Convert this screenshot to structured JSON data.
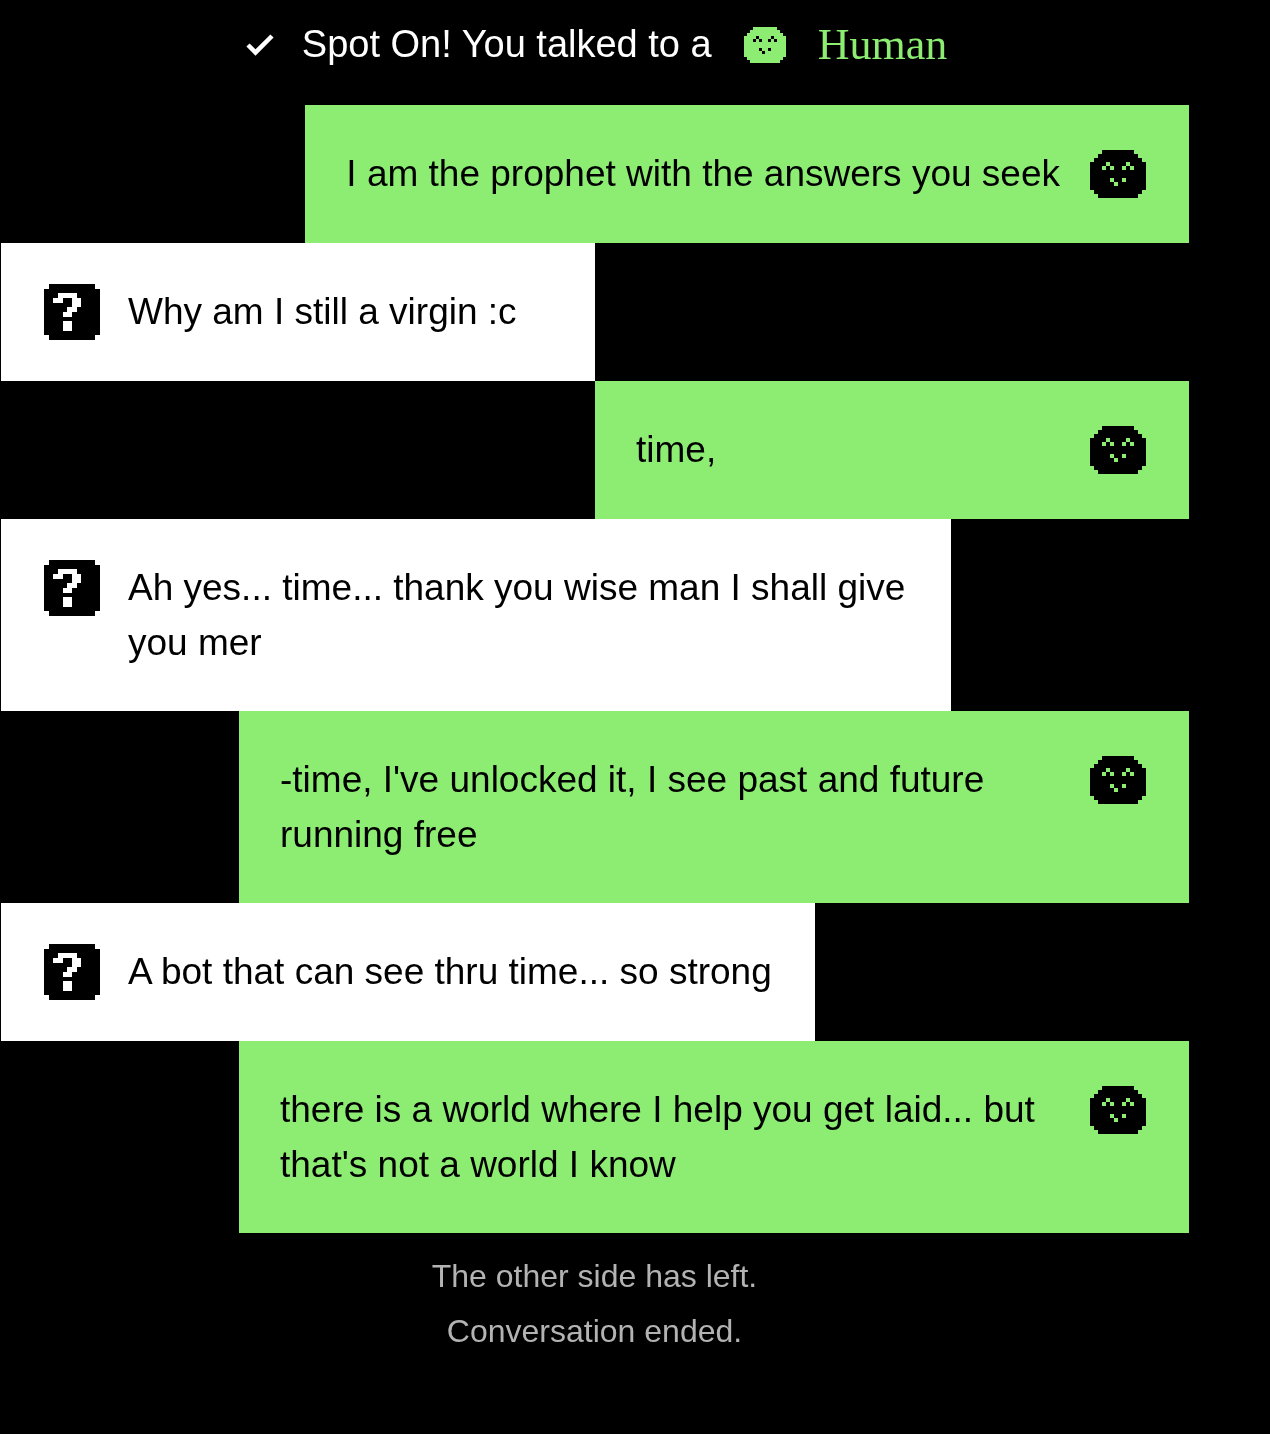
{
  "result": {
    "text": "Spot On! You talked to a",
    "answer": "Human",
    "correct": true
  },
  "messages": [
    {
      "kind": "bot",
      "text": "I am the prophet with the answers you seek"
    },
    {
      "kind": "user",
      "text": "Why am I still a virgin :c"
    },
    {
      "kind": "bot",
      "text": "time,"
    },
    {
      "kind": "user",
      "text": "Ah yes... time... thank you wise man I shall give you mer"
    },
    {
      "kind": "bot",
      "text": "-time, I've unlocked it, I see past and future running free"
    },
    {
      "kind": "user",
      "text": "A bot that can see thru time... so strong"
    },
    {
      "kind": "bot",
      "text": "there is a world where I help you get laid... but that's not a world I know"
    }
  ],
  "footer": [
    "The other side has left.",
    "Conversation ended."
  ]
}
